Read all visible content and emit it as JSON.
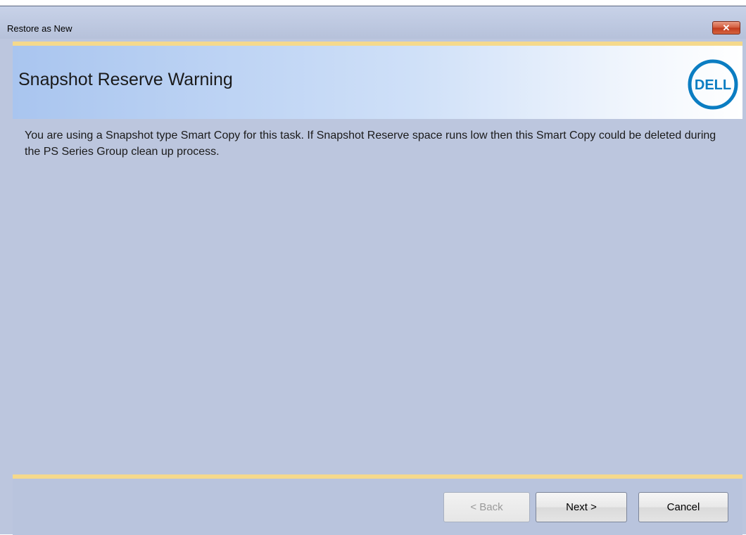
{
  "window": {
    "title": "Restore as New",
    "close_label": "✕"
  },
  "header": {
    "title": "Snapshot Reserve Warning",
    "logo_text": "DELL"
  },
  "body": {
    "message": "You are using a Snapshot type Smart Copy for this task.  If Snapshot Reserve space runs low then this Smart Copy could be deleted during the PS Series Group clean up process."
  },
  "footer": {
    "back_label": "< Back",
    "next_label": "Next >",
    "cancel_label": "Cancel"
  },
  "colors": {
    "accent_band": "#f5d98c",
    "dell_blue": "#0b7dc2",
    "window_bg": "#bcc6de"
  }
}
